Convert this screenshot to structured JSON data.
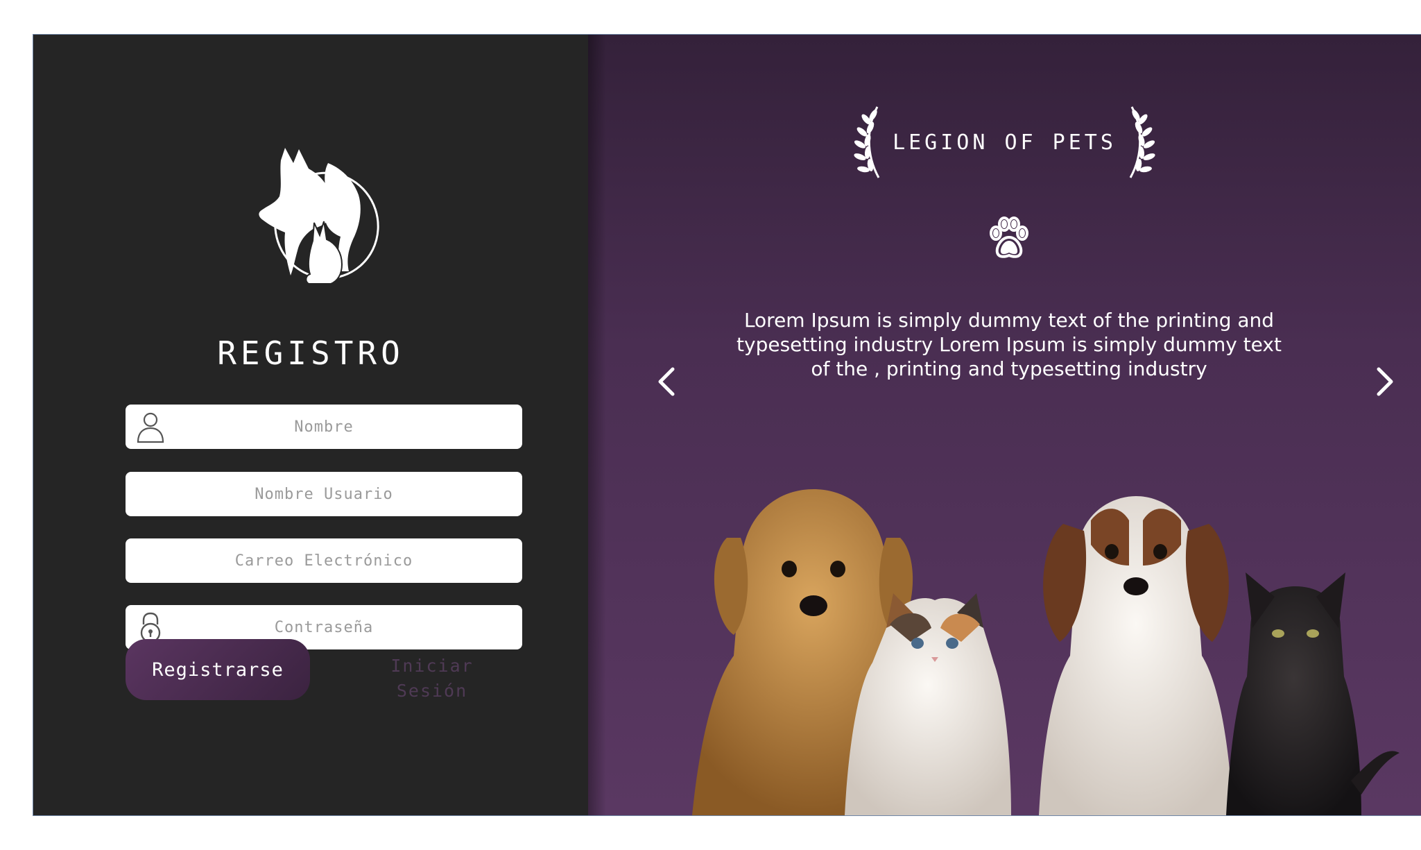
{
  "colors": {
    "left_panel_bg": "#252525",
    "right_panel_top": "#34213a",
    "right_panel_bottom": "#5a3862",
    "primary_button": "#4a2c50",
    "link_text": "#4f3a55"
  },
  "form": {
    "title": "REGISTRO",
    "fields": {
      "name": {
        "placeholder": "Nombre",
        "value": "",
        "icon": "user-icon"
      },
      "username": {
        "placeholder": "Nombre Usuario",
        "value": ""
      },
      "email": {
        "placeholder": "Carreo Electrónico",
        "value": ""
      },
      "password": {
        "placeholder": "Contraseña",
        "value": "",
        "icon": "lock-icon"
      }
    },
    "register_label": "Registrarse",
    "login_link_line1": "Iniciar",
    "login_link_line2": "Sesión"
  },
  "logo": {
    "icon": "pets-silhouette-logo"
  },
  "showcase": {
    "brand": "LEGION OF PETS",
    "paw_icon": "paw-icon",
    "description": "Lorem Ipsum is simply dummy text of the printing and typesetting industry Lorem Ipsum is simply dummy text of the , printing and typesetting industry",
    "prev_icon": "chevron-left-icon",
    "next_icon": "chevron-right-icon",
    "image": "dogs-and-cats-photo"
  }
}
